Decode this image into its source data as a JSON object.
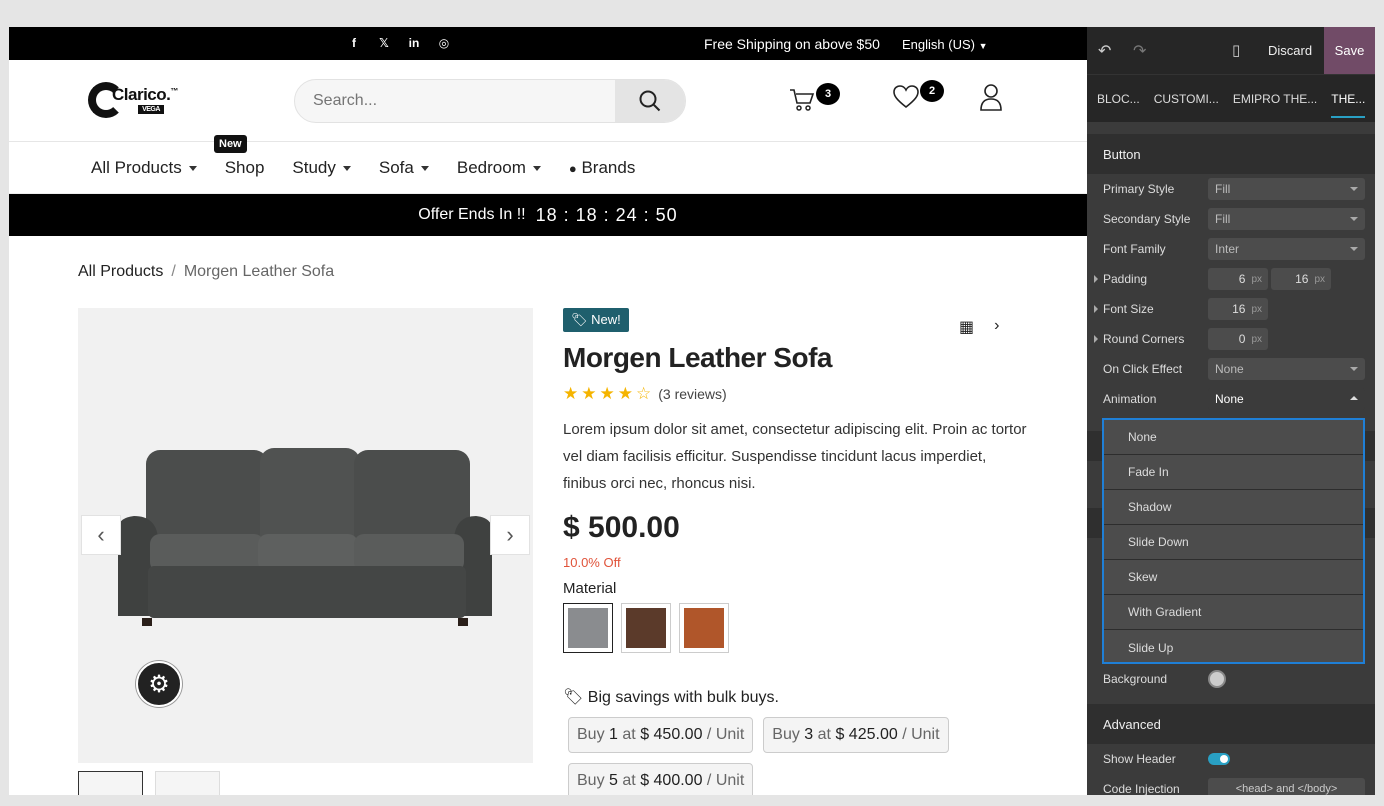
{
  "topbar": {
    "social": [
      "f",
      "𝕏",
      "in",
      "◎"
    ],
    "shipping": "Free Shipping on above $50",
    "language": "English (US)"
  },
  "header": {
    "logo_name": "Clarico.",
    "logo_tm": "™",
    "logo_sub": "VEGA",
    "search_placeholder": "Search...",
    "cart_count": "3",
    "wishlist_count": "2"
  },
  "nav": {
    "new_tag": "New",
    "items": [
      "All Products",
      "Shop",
      "Study",
      "Sofa",
      "Bedroom",
      "Brands"
    ]
  },
  "offer": {
    "label": "Offer Ends In !!",
    "timer": "18 : 18 : 24 : 50"
  },
  "breadcrumb": {
    "parent": "All Products",
    "sep": "/",
    "current": "Morgen Leather Sofa"
  },
  "product": {
    "badge": "New!",
    "title": "Morgen Leather Sofa",
    "rating": 4,
    "reviews": "(3 reviews)",
    "description": "Lorem ipsum dolor sit amet, consectetur adipiscing elit. Proin ac tortor vel diam facilisis efficitur. Suspendisse tincidunt lacus imperdiet, finibus orci nec, rhoncus nisi.",
    "price": "$ 500.00",
    "discount": "10.0% Off",
    "material_label": "Material",
    "swatch_colors": [
      "#8a8c8f",
      "#5b3a2a",
      "#b0562a"
    ],
    "bulk_label": "Big savings with bulk buys.",
    "tiers": [
      {
        "buy": "Buy",
        "qty": "1",
        "at": "at",
        "price": "$ 450.00",
        "unit": "/ Unit"
      },
      {
        "buy": "Buy",
        "qty": "3",
        "at": "at",
        "price": "$ 425.00",
        "unit": "/ Unit"
      },
      {
        "buy": "Buy",
        "qty": "5",
        "at": "at",
        "price": "$ 400.00",
        "unit": "/ Unit"
      }
    ]
  },
  "panel": {
    "discard": "Discard",
    "save": "Save",
    "tabs": [
      "BLOC...",
      "CUSTOMI...",
      "EMIPRO THE...",
      "THE..."
    ],
    "section_button": "Button",
    "rows": {
      "primary_style": {
        "label": "Primary Style",
        "value": "Fill"
      },
      "secondary_style": {
        "label": "Secondary Style",
        "value": "Fill"
      },
      "font_family": {
        "label": "Font Family",
        "value": "Inter"
      },
      "padding": {
        "label": "Padding",
        "v1": "6",
        "v2": "16",
        "unit": "px"
      },
      "font_size": {
        "label": "Font Size",
        "value": "16",
        "unit": "px"
      },
      "round_corners": {
        "label": "Round Corners",
        "value": "0",
        "unit": "px"
      },
      "on_click": {
        "label": "On Click Effect",
        "value": "None"
      },
      "animation": {
        "label": "Animation",
        "value": "None"
      }
    },
    "animation_options": [
      "None",
      "Fade In",
      "Shadow",
      "Slide Down",
      "Skew",
      "With Gradient",
      "Slide Up"
    ],
    "background_label": "Background",
    "section_advanced": "Advanced",
    "show_header": "Show Header",
    "code_injection": "Code Injection",
    "code_injection_value": "<head> and </body>"
  }
}
